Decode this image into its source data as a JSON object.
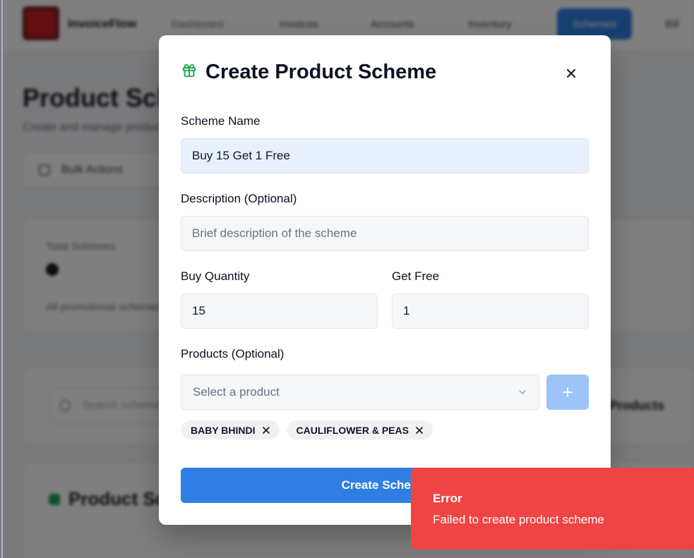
{
  "app": {
    "brand_name": "InvoiceFlow",
    "brand_sub": "Dashboard",
    "nav": [
      "Invoices",
      "Accounts",
      "Inventory",
      "Schemes",
      "Bill"
    ],
    "page_title": "Product Schemes",
    "page_subtitle": "Create and manage product schemes",
    "bulk_actions": "Bulk Actions",
    "stat_label": "Total Schemes",
    "stat_note": "All promotional schemes",
    "search_placeholder": "Search schemes",
    "search_right": "Products",
    "list_title": "Product Schemes"
  },
  "modal": {
    "title": "Create Product Scheme",
    "icon": "gift-icon",
    "accent_color": "#16a34a",
    "fields": {
      "scheme_name": {
        "label": "Scheme Name",
        "value": "Buy 15 Get 1 Free"
      },
      "description": {
        "label": "Description (Optional)",
        "placeholder": "Brief description of the scheme",
        "value": ""
      },
      "buy_quantity": {
        "label": "Buy Quantity",
        "value": "15"
      },
      "get_free": {
        "label": "Get Free",
        "value": "1"
      },
      "products": {
        "label": "Products (Optional)",
        "placeholder": "Select a product"
      }
    },
    "selected_products": [
      "BABY BHINDI",
      "CAULIFLOWER & PEAS"
    ],
    "submit_label": "Create Scheme",
    "submit_color": "#2f7fe3"
  },
  "toast": {
    "title": "Error",
    "message": "Failed to create product scheme",
    "color": "#ef4444"
  }
}
